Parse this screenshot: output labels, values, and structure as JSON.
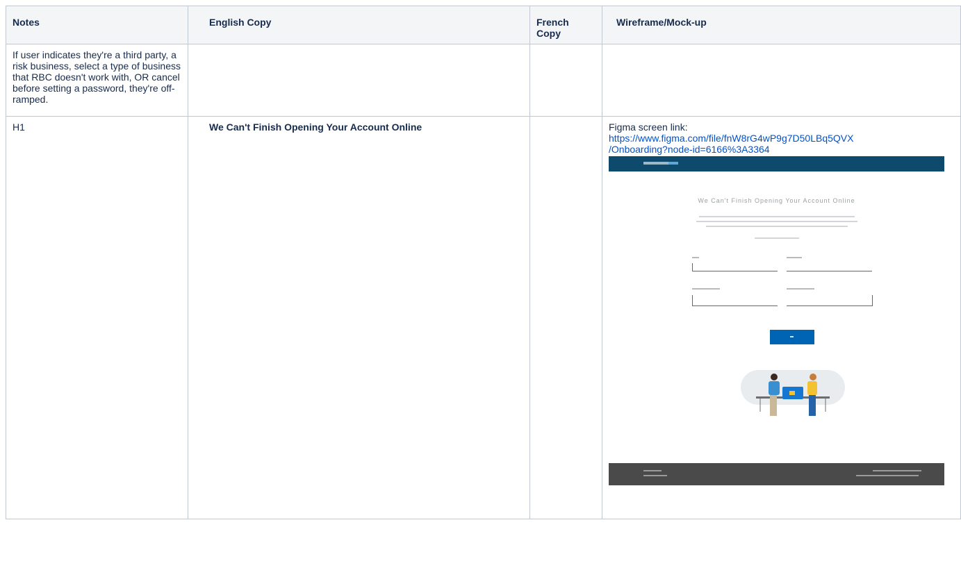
{
  "table": {
    "headers": {
      "notes": "Notes",
      "english": "English Copy",
      "french": "French Copy",
      "wireframe": "Wireframe/Mock-up"
    },
    "rows": [
      {
        "notes": "If user indicates they're a third party, a risk business, select a type of business that RBC doesn't work with, OR cancel before setting a password, they're off-ramped.",
        "english": "",
        "french": "",
        "wireframe": ""
      },
      {
        "notes": "H1",
        "english": "We Can't Finish Opening Your Account Online",
        "french": "",
        "wireframe_label": "Figma screen link:",
        "wireframe_link_line1": "https://www.figma.com/file/fnW8rG4wP9g7D50LBq5QVX",
        "wireframe_link_line2": "/Onboarding?node-id=6166%3A3364",
        "mockup_title": "We Can't Finish Opening Your Account Online"
      }
    ]
  },
  "colors": {
    "header_bg": "#f4f5f7",
    "border": "#c1c7d0",
    "link": "#0052cc",
    "mock_header": "#0e4a6b",
    "mock_button": "#0064b4",
    "mock_footer": "#4a4a4a"
  }
}
